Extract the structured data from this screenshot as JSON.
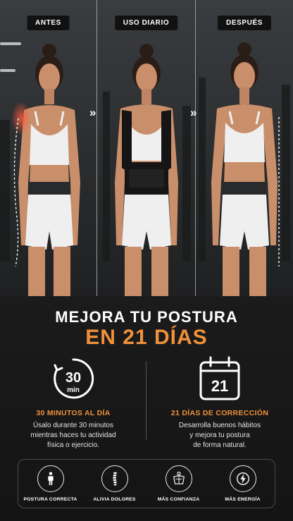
{
  "panels": [
    {
      "label": "ANTES"
    },
    {
      "label": "USO DIARIO"
    },
    {
      "label": "DESPUÉS"
    }
  ],
  "arrow_glyph": "»",
  "headline": {
    "line1": "MEJORA TU POSTURA",
    "line2": "EN 21 DÍAS"
  },
  "features": [
    {
      "icon": "timer-icon",
      "icon_number": "30",
      "icon_unit": "min",
      "title": "30 MINUTOS AL DÍA",
      "body_lines": [
        "Úsalo durante 30 minutos",
        "mientras haces tu actividad",
        "física o ejercicio."
      ]
    },
    {
      "icon": "calendar-icon",
      "icon_number": "21",
      "title": "21 DÍAS DE CORRECCIÓN",
      "body_lines": [
        "Desarrolla buenos hábitos",
        "y mejora tu postura",
        "de forma natural."
      ]
    }
  ],
  "benefits": [
    {
      "icon": "standing-person-icon",
      "label": "POSTURA CORRECTA"
    },
    {
      "icon": "spine-icon",
      "label": "ALIVIA DOLORES"
    },
    {
      "icon": "back-muscles-icon",
      "label": "MÁS CONFIANZA"
    },
    {
      "icon": "lightning-icon",
      "label": "MÁS ENERGÍA"
    }
  ],
  "colors": {
    "accent": "#f0913a",
    "background": "#161616",
    "pain_highlight": "#ff5a3c",
    "brace": "#151515",
    "clothing": "#efefef",
    "skin": "#c98e6a"
  }
}
